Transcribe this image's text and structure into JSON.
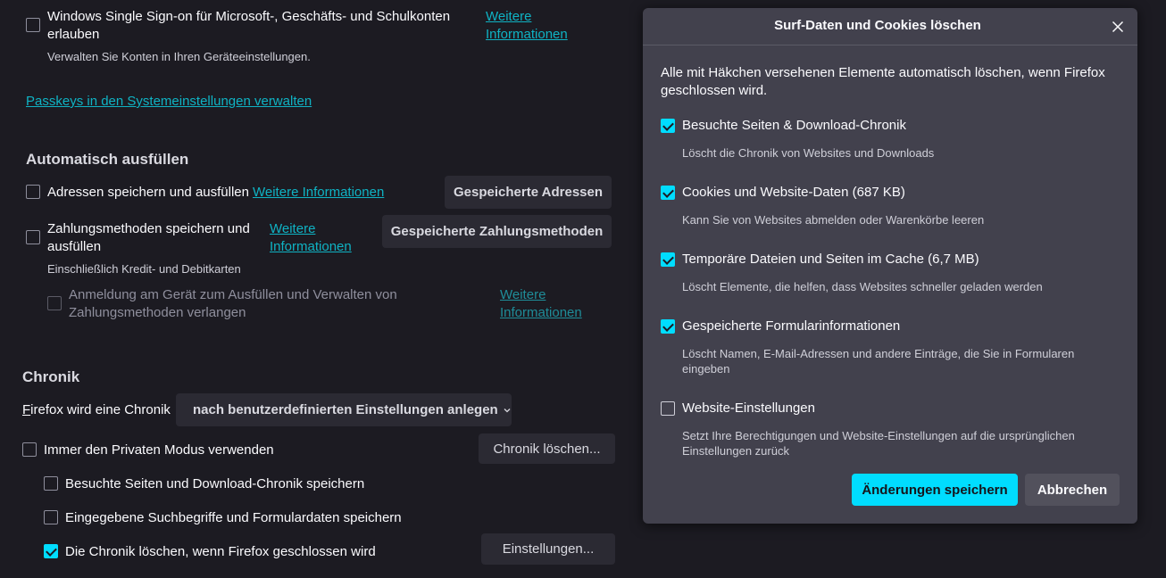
{
  "bg": {
    "sso": {
      "label": "Windows Single Sign-on für Microsoft-, Geschäfts- und Schulkonten erlauben",
      "link_label": "Weitere Informationen",
      "description": "Verwalten Sie Konten in Ihren Geräteeinstellungen."
    },
    "passkeys_link": "Passkeys in den Systemeinstellungen verwalten",
    "autofill": {
      "title": "Automatisch ausfüllen",
      "addresses_label": "Adressen speichern und ausfüllen",
      "addresses_link": "Weitere Informationen",
      "addresses_button": "Gespeicherte Adressen",
      "payment_label": "Zahlungsmethoden speichern und ausfüllen",
      "payment_link": "Weitere Informationen",
      "payment_button": "Gespeicherte Zahlungsmethoden",
      "payment_description": "Einschließlich Kredit- und Debitkarten",
      "device_auth_label": "Anmeldung am Gerät zum Ausfüllen und Verwalten von Zahlungsmethoden verlangen",
      "device_auth_link": "Weitere Informationen"
    },
    "history": {
      "title": "Chronik",
      "mode_label": "Firefox wird eine Chronik",
      "mode_value": "nach benutzerdefinierten Einstellungen anlegen",
      "private_label": "Immer den Privaten Modus verwenden",
      "clear_button": "Chronik löschen...",
      "save_browsing_label": "Besuchte Seiten und Download-Chronik speichern",
      "save_search_label": "Eingegebene Suchbegriffe und Formulardaten speichern",
      "clear_on_close_label": "Die Chronik löschen, wenn Firefox geschlossen wird",
      "settings_button": "Einstellungen..."
    }
  },
  "dialog": {
    "title": "Surf-Daten und Cookies löschen",
    "intro": "Alle mit Häkchen versehenen Elemente automatisch löschen, wenn Firefox geschlossen wird.",
    "options": [
      {
        "label": "Besuchte Seiten & Download-Chronik",
        "description": "Löscht die Chronik von Websites und Downloads",
        "checked": true
      },
      {
        "label": "Cookies und Website-Daten (687 KB)",
        "description": "Kann Sie von Websites abmelden oder Warenkörbe leeren",
        "checked": true
      },
      {
        "label": "Temporäre Dateien und Seiten im Cache (6,7 MB)",
        "description": "Löscht Elemente, die helfen, dass Websites schneller geladen werden",
        "checked": true
      },
      {
        "label": "Gespeicherte Formularinformationen",
        "description": "Löscht Namen, E-Mail-Adressen und andere Einträge, die Sie in Formularen eingeben",
        "checked": true
      },
      {
        "label": "Website-Einstellungen",
        "description": "Setzt Ihre Berechtigungen und Website-Einstellungen auf die ursprünglichen Einstellungen zurück",
        "checked": false
      }
    ],
    "save_button": "Änderungen speichern",
    "cancel_button": "Abbrechen"
  },
  "colors": {
    "background": "#1c1b22",
    "dialog": "#42414d",
    "accent": "#00ddff",
    "link": "#0fb3c4"
  }
}
